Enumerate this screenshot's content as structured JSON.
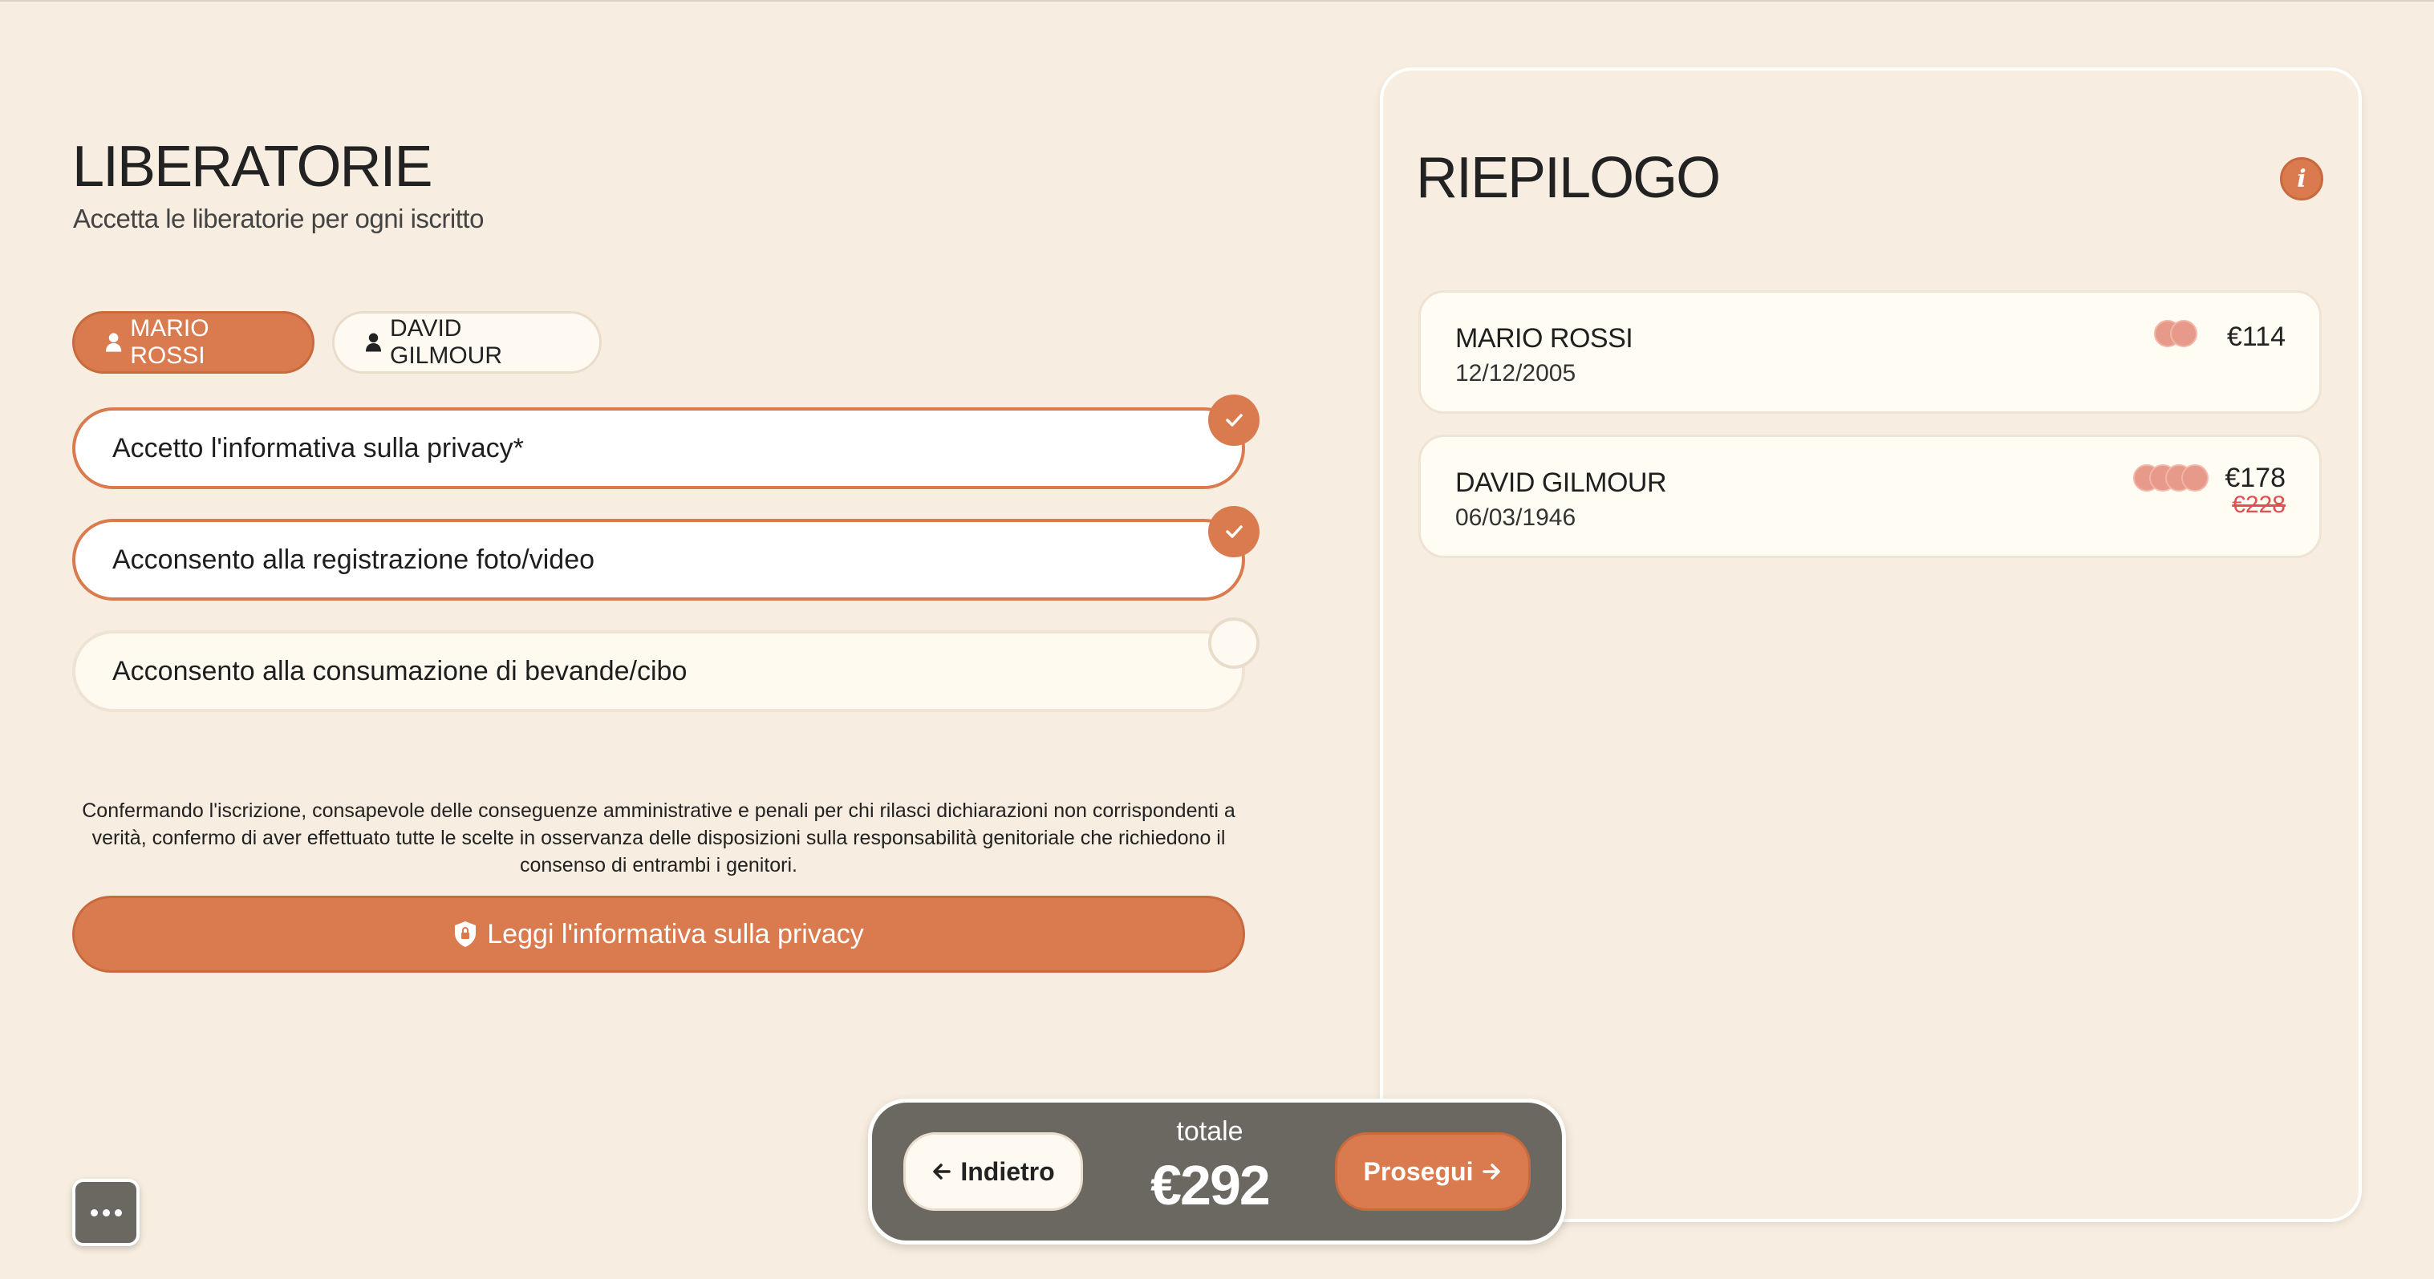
{
  "left": {
    "title": "LIBERATORIE",
    "subtitle": "Accetta le liberatorie per ogni iscritto",
    "participants": [
      {
        "label": "MARIO ROSSI",
        "selected": true
      },
      {
        "label": "DAVID GILMOUR",
        "selected": false
      }
    ],
    "consents": [
      {
        "label": "Accetto l'informativa sulla privacy*",
        "checked": true
      },
      {
        "label": "Acconsento alla registrazione foto/video",
        "checked": true
      },
      {
        "label": "Acconsento alla consumazione di bevande/cibo",
        "checked": false
      }
    ],
    "disclaimer": "Confermando l'iscrizione, consapevole delle conseguenze amministrative e penali per chi rilasci dichiarazioni non corrispondenti a verità, confermo di aver effettuato tutte le scelte in osservanza delle disposizioni sulla responsabilità genitoriale che richiedono il consenso di entrambi i genitori.",
    "privacy_button": "Leggi l'informativa sulla privacy"
  },
  "summary": {
    "title": "RIEPILOGO",
    "info_icon": "i",
    "entries": [
      {
        "name": "MARIO ROSSI",
        "birthdate": "12/12/2005",
        "price": "€114",
        "old_price": "",
        "dots": 2
      },
      {
        "name": "DAVID GILMOUR",
        "birthdate": "06/03/1946",
        "price": "€178",
        "old_price": "€228",
        "dots": 4
      }
    ]
  },
  "footer": {
    "back_label": "Indietro",
    "total_label": "totale",
    "total_value": "€292",
    "next_label": "Prosegui"
  },
  "colors": {
    "accent": "#d97b4f",
    "background": "#f7ede0",
    "bar": "#6b6862",
    "strike": "#e05050"
  }
}
